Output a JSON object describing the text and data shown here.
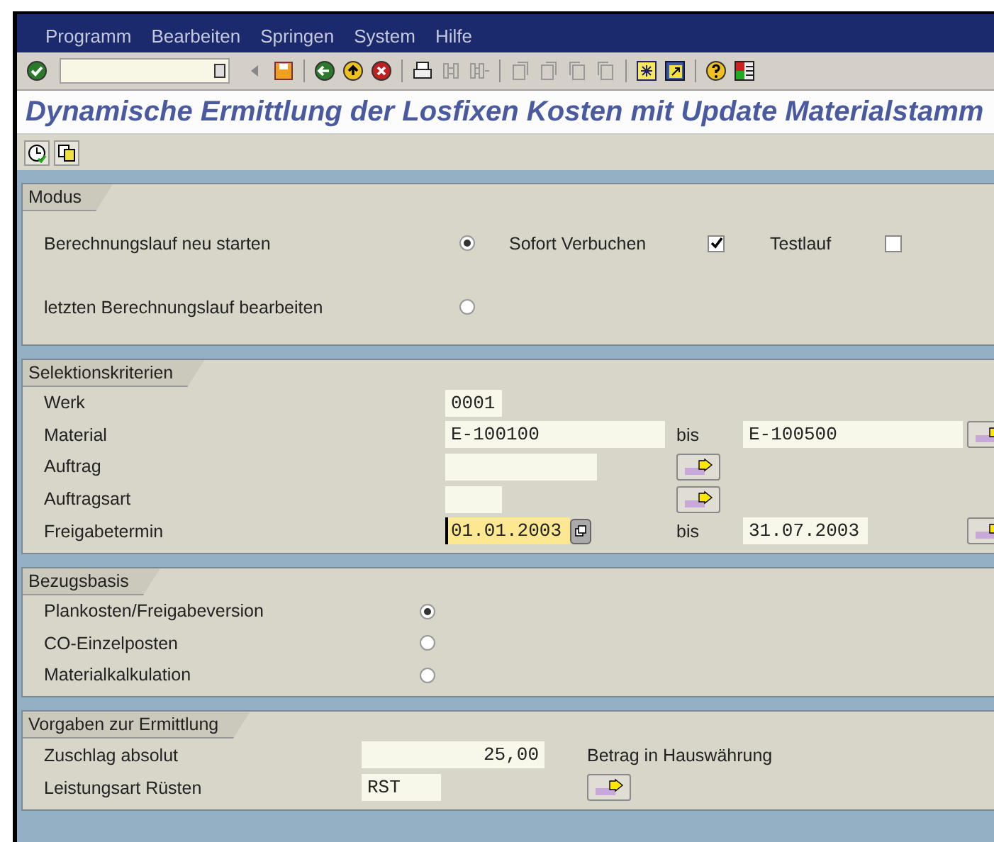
{
  "menu": [
    "Programm",
    "Bearbeiten",
    "Springen",
    "System",
    "Hilfe"
  ],
  "title": "Dynamische Ermittlung der Losfixen Kosten mit Update Materialstamm",
  "sections": [
    {
      "kind": "modus",
      "title": "Modus",
      "rows": [
        {
          "label": "Berechnungslauf neu starten",
          "selected": true,
          "options": [
            {
              "label": "Sofort Verbuchen",
              "checked": true
            },
            {
              "label": "Testlauf",
              "checked": false
            }
          ]
        },
        {
          "label": "letzten Berechnungslauf bearbeiten",
          "selected": false,
          "options": []
        }
      ]
    },
    {
      "kind": "selection",
      "title": "Selektionskriterien",
      "rows": [
        {
          "label": "Werk",
          "low": "0001",
          "focused": false,
          "more_button": false
        },
        {
          "label": "Material",
          "low": "E-100100",
          "focused": false,
          "to_label": "bis",
          "high": "E-100500",
          "more_button": true
        },
        {
          "label": "Auftrag",
          "low": "",
          "focused": false,
          "more_button": true
        },
        {
          "label": "Auftragsart",
          "low": "",
          "focused": false,
          "more_button": true
        },
        {
          "label": "Freigabetermin",
          "low": "01.01.2003",
          "focused": true,
          "to_label": "bis",
          "high": "31.07.2003",
          "more_button": true
        }
      ]
    },
    {
      "kind": "basis",
      "title": "Bezugsbasis",
      "rows": [
        {
          "label": "Plankosten/Freigabeversion",
          "selected": true
        },
        {
          "label": "CO-Einzelposten",
          "selected": false
        },
        {
          "label": "Materialkalkulation",
          "selected": false
        }
      ]
    },
    {
      "kind": "defaults",
      "title": "Vorgaben zur Ermittlung",
      "rows": [
        {
          "label": "Zuschlag absolut",
          "value": "25,00",
          "note": "Betrag in Hauswährung",
          "more_button": false
        },
        {
          "label": "Leistungsart Rüsten",
          "value": "RST",
          "more_button": true
        }
      ]
    }
  ]
}
